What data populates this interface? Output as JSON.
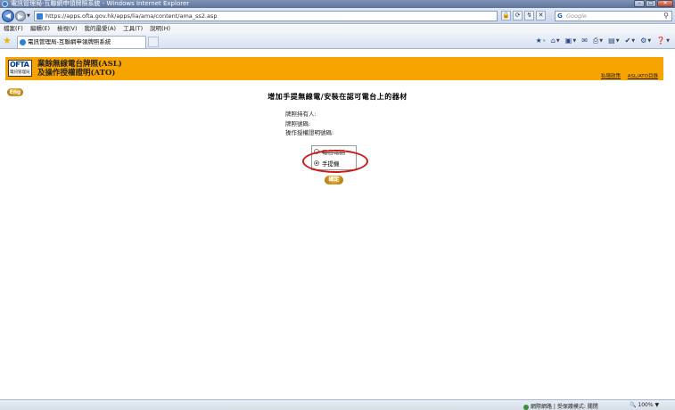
{
  "window": {
    "title": "電訊管理局-互聯網申領牌照系統 - Windows Internet Explorer",
    "minimize": "–",
    "maximize": "□",
    "close": "✕"
  },
  "address": {
    "url": "https://apps.ofta.gov.hk/apps/lia/ama/content/ama_ss2.asp",
    "search_placeholder": "Google",
    "search_engine_glyph": "G"
  },
  "menu": [
    "檔案(F)",
    "編輯(E)",
    "檢視(V)",
    "我的最愛(A)",
    "工具(T)",
    "說明(H)"
  ],
  "tab": {
    "title": "電訊管理局-互聯網申領牌照系統"
  },
  "banner": {
    "logo_text": "OFTA",
    "logo_sub": "電訊管理局",
    "title_line1": "業餘無線電台牌照(ASL)",
    "title_line2": "及操作授權證明(ATO)",
    "link_privacy": "私隱政策",
    "link_home": "ASL/ATO目錄"
  },
  "page": {
    "eng_button": "Eng",
    "heading": "增加手提無線電/安裝在認可電台上的器材",
    "field_holder": "牌照持有人:",
    "field_licence": "牌照號碼:",
    "field_ato": "操作授權證明號碼:",
    "option_fixed": "電台電話",
    "option_handheld": "手提機",
    "selected": "手提機",
    "confirm_button": "確定"
  },
  "status": {
    "zone": "網際網路 | 受保護模式: 關閉",
    "zoom": "100%"
  },
  "colors": {
    "banner": "#f7a300",
    "highlight_ring": "#c91a1a",
    "button": "#c48a10"
  }
}
